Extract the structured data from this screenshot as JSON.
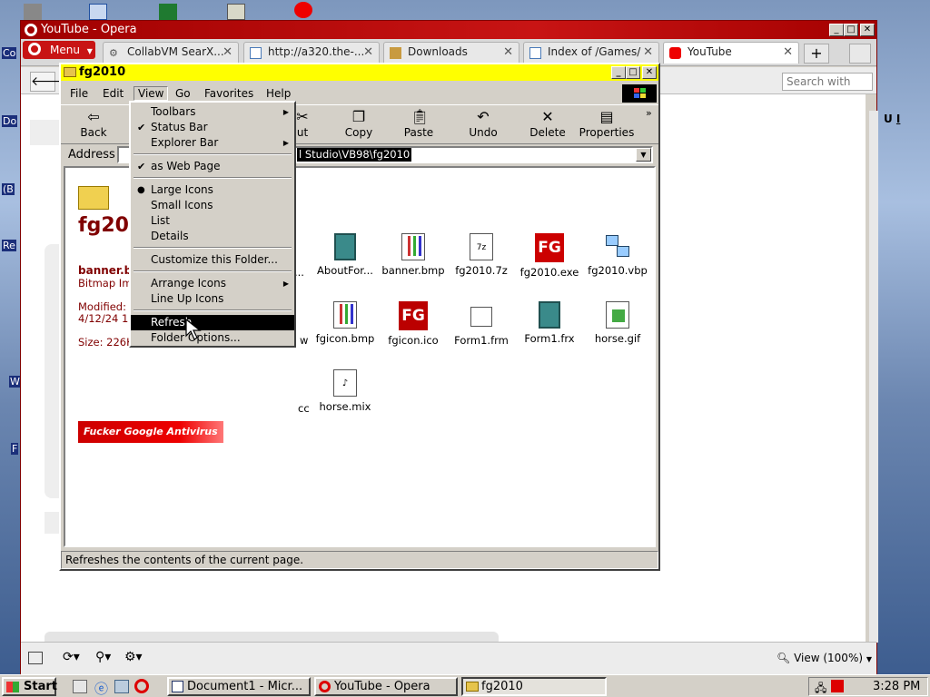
{
  "opera": {
    "title": "YouTube - Opera",
    "menu_label": "Menu",
    "tabs": [
      {
        "label": "CollabVM SearX..."
      },
      {
        "label": "http://a320.the-..."
      },
      {
        "label": "Downloads"
      },
      {
        "label": "Index of /Games/"
      },
      {
        "label": "YouTube"
      }
    ],
    "search_placeholder": "Search with",
    "zoom_label": "View (100%)",
    "add_tab": "+"
  },
  "explorer": {
    "title": "fg2010",
    "menus": [
      "File",
      "Edit",
      "View",
      "Go",
      "Favorites",
      "Help"
    ],
    "toolbar": [
      {
        "label": "Back",
        "icon": "back-arrow-icon"
      },
      {
        "label": "Cut",
        "icon": "scissors-icon"
      },
      {
        "label": "Copy",
        "icon": "copy-icon"
      },
      {
        "label": "Paste",
        "icon": "paste-icon"
      },
      {
        "label": "Undo",
        "icon": "undo-icon"
      },
      {
        "label": "Delete",
        "icon": "delete-x-icon"
      },
      {
        "label": "Properties",
        "icon": "properties-icon"
      }
    ],
    "toolbar_cut_partial": "ut",
    "address_label": "Address",
    "address_value": "l Studio\\VB98\\fg2010",
    "folder_heading": "fg20",
    "selected_file": {
      "name": "banner.b",
      "type": "Bitmap Im",
      "modified_label": "Modified:",
      "modified_value": "4/12/24 1",
      "size": "Size: 226K"
    },
    "banner_text": "Fucker Google Antivirus",
    "partial_labels": [
      "...",
      "w",
      "cc"
    ],
    "files": [
      {
        "name": "AboutFor...",
        "icon": "form-icon"
      },
      {
        "name": "banner.bmp",
        "icon": "bitmap-icon"
      },
      {
        "name": "fg2010.7z",
        "icon": "archive-icon"
      },
      {
        "name": "fg2010.exe",
        "icon": "fg-app-icon"
      },
      {
        "name": "fg2010.vbp",
        "icon": "vb-project-icon"
      },
      {
        "name": "fgicon.bmp",
        "icon": "bitmap-icon"
      },
      {
        "name": "fgicon.ico",
        "icon": "fg-app-icon"
      },
      {
        "name": "Form1.frm",
        "icon": "form-file-icon"
      },
      {
        "name": "Form1.frx",
        "icon": "form-icon"
      },
      {
        "name": "horse.gif",
        "icon": "gif-icon"
      },
      {
        "name": "horse.mix",
        "icon": "mix-icon"
      }
    ],
    "status": "Refreshes the contents of the current page."
  },
  "view_menu": {
    "items": [
      {
        "label": "Toolbars",
        "submenu": true
      },
      {
        "label": "Status Bar",
        "check": true
      },
      {
        "label": "Explorer Bar",
        "submenu": true
      },
      {
        "label": "as Web Page",
        "check": true
      },
      {
        "label": "Large Icons",
        "radio": true
      },
      {
        "label": "Small Icons"
      },
      {
        "label": "List"
      },
      {
        "label": "Details"
      },
      {
        "label": "Customize this Folder..."
      },
      {
        "label": "Arrange Icons",
        "submenu": true
      },
      {
        "label": "Line Up Icons"
      },
      {
        "label": "Refresh",
        "highlighted": true
      },
      {
        "label": "Folder Options..."
      }
    ]
  },
  "desktop_labels": [
    "Co",
    "Do",
    "(B",
    "Re",
    "W",
    "F"
  ],
  "taskbar": {
    "start": "Start",
    "tasks": [
      {
        "label": "Document1 - Micr..."
      },
      {
        "label": "YouTube - Opera"
      },
      {
        "label": "fg2010"
      }
    ],
    "clock": "3:28 PM"
  },
  "colors": {
    "opera_red": "#c81414",
    "explorer_title": "#ffff00",
    "win_face": "#d4d0c8"
  }
}
